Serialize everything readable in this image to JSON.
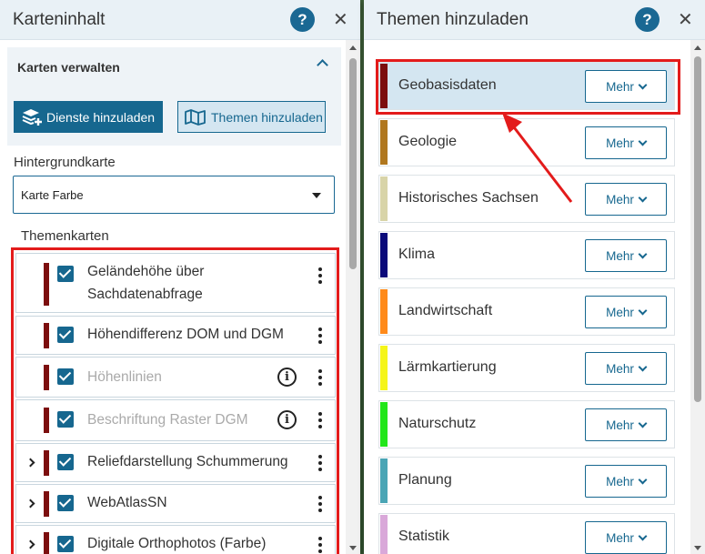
{
  "left_panel": {
    "title": "Karteninhalt",
    "help_label": "?",
    "close_label": "✕",
    "manage_title": "Karten verwalten",
    "add_services_label": "Dienste hinzuladen",
    "add_themes_label": "Themen hinzuladen",
    "basemap_label": "Hintergrundkarte",
    "basemap_value": "Karte Farbe",
    "thematic_label": "Themenkarten",
    "layers": [
      {
        "label_line1": "Geländehöhe über",
        "label_line2": "Sachdatenabfrage",
        "checked": true,
        "dimmed": false,
        "expandable": false,
        "info": false
      },
      {
        "label": "Höhendifferenz DOM und DGM",
        "checked": true,
        "dimmed": false,
        "expandable": false,
        "info": false
      },
      {
        "label": "Höhenlinien",
        "checked": true,
        "dimmed": true,
        "expandable": false,
        "info": true
      },
      {
        "label": "Beschriftung Raster DGM",
        "checked": true,
        "dimmed": true,
        "expandable": false,
        "info": true
      },
      {
        "label": "Reliefdarstellung Schummerung",
        "checked": true,
        "dimmed": false,
        "expandable": true,
        "info": false
      },
      {
        "label": "WebAtlasSN",
        "checked": true,
        "dimmed": false,
        "expandable": true,
        "info": false
      },
      {
        "label": "Digitale Orthophotos (Farbe)",
        "checked": true,
        "dimmed": false,
        "expandable": true,
        "info": false
      }
    ],
    "info_glyph": "i"
  },
  "right_panel": {
    "title": "Themen hinzuladen",
    "help_label": "?",
    "close_label": "✕",
    "more_label": "Mehr",
    "themes": [
      {
        "name": "Geobasisdaten",
        "color": "#7c0e0e"
      },
      {
        "name": "Geologie",
        "color": "#b0771e"
      },
      {
        "name": "Historisches Sachsen",
        "color": "#d8d4a8"
      },
      {
        "name": "Klima",
        "color": "#0a0a7a"
      },
      {
        "name": "Landwirtschaft",
        "color": "#ff8a1a"
      },
      {
        "name": "Lärmkartierung",
        "color": "#f5f51a"
      },
      {
        "name": "Naturschutz",
        "color": "#22e61a"
      },
      {
        "name": "Planung",
        "color": "#4aa5b5"
      },
      {
        "name": "Statistik",
        "color": "#d9a8d9"
      }
    ]
  },
  "colors": {
    "accent": "#16678f",
    "highlight": "#e31b1b",
    "layer_bar": "#7c0e0e"
  }
}
